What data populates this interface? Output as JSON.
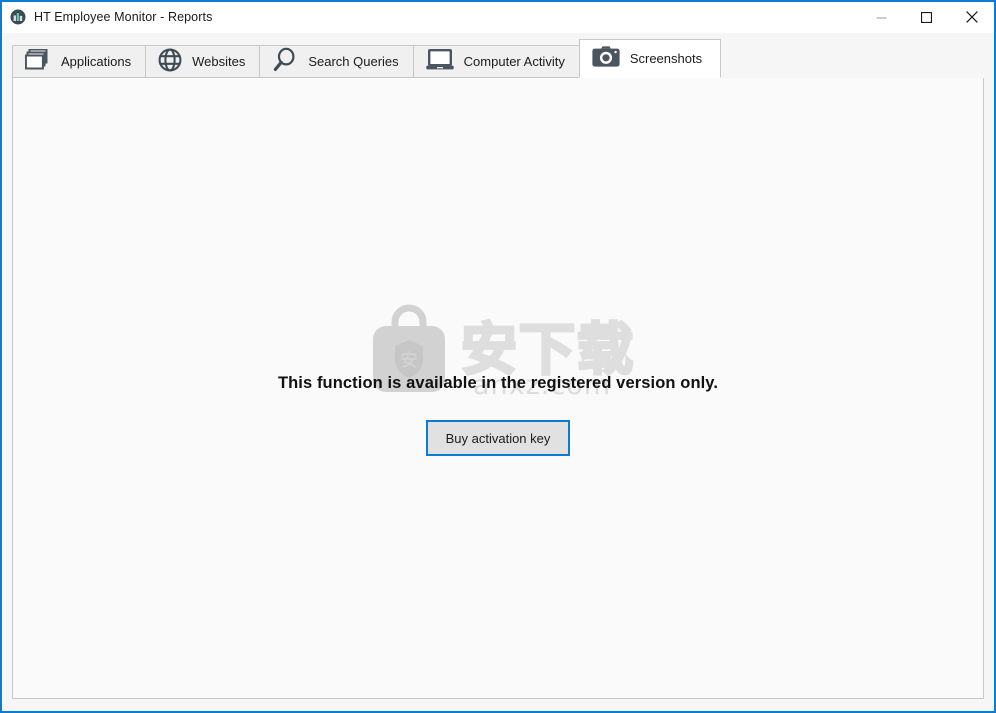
{
  "window": {
    "title": "HT Employee Monitor - Reports",
    "icon": "app-chart-icon",
    "accent_color": "#0a7cd1",
    "controls": {
      "minimize": "minimize-icon",
      "maximize": "maximize-icon",
      "close": "close-icon"
    }
  },
  "tabs": [
    {
      "label": "Applications",
      "icon": "windows-stack-icon",
      "active": false
    },
    {
      "label": "Websites",
      "icon": "globe-icon",
      "active": false
    },
    {
      "label": "Search Queries",
      "icon": "magnifier-icon",
      "active": false
    },
    {
      "label": "Computer Activity",
      "icon": "laptop-icon",
      "active": false
    },
    {
      "label": "Screenshots",
      "icon": "camera-icon",
      "active": true
    }
  ],
  "content": {
    "notice": "This function is available in the registered version only.",
    "buy_button_label": "Buy activation key",
    "watermark": {
      "chinese_text": "安下载",
      "url_text": "anxz.com",
      "logo": "shield-bag-icon",
      "color": "#dedede"
    },
    "background_color": "#fafafa"
  }
}
